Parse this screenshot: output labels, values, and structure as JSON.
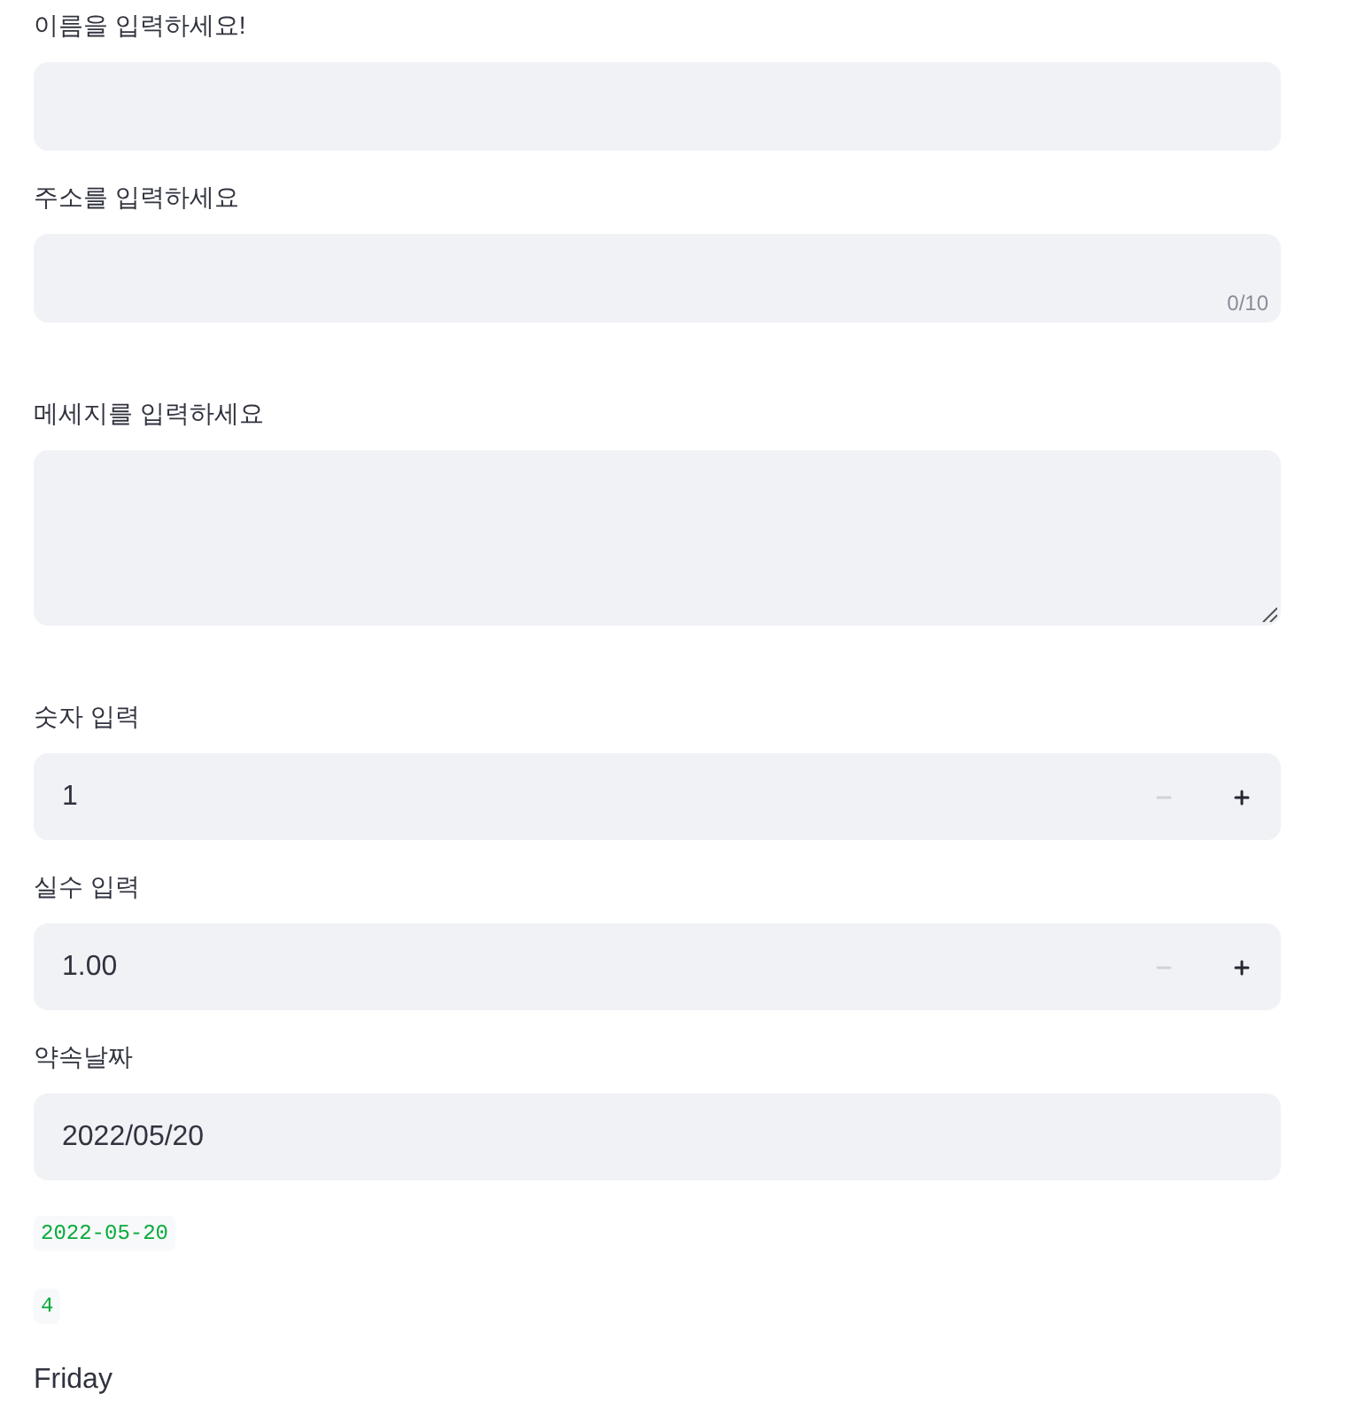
{
  "fields": [
    {
      "kind": "text",
      "label": "이름을 입력하세요!"
    },
    {
      "kind": "text",
      "label": "주소를 입력하세요",
      "counter": "0/10"
    },
    {
      "kind": "textarea",
      "label": "메세지를 입력하세요"
    },
    {
      "kind": "number",
      "label": "숫자 입력",
      "value": "1",
      "minus_disabled": true,
      "plus_disabled": false
    },
    {
      "kind": "number",
      "label": "실수 입력",
      "value": "1.00",
      "minus_disabled": true,
      "plus_disabled": false
    },
    {
      "kind": "date",
      "label": "약속날짜",
      "value": "2022/05/20"
    }
  ],
  "outputs": [
    {
      "kind": "code",
      "text": "2022-05-20"
    },
    {
      "kind": "code",
      "text": "4"
    },
    {
      "kind": "text",
      "text": "Friday"
    }
  ]
}
